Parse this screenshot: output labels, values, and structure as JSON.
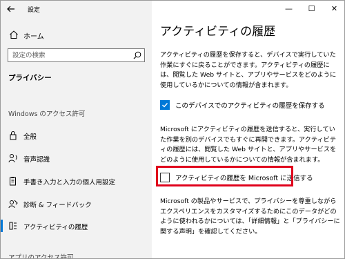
{
  "window": {
    "title": "設定",
    "controls": {
      "minimize": "—",
      "maximize": "☐",
      "close": "✕"
    }
  },
  "sidebar": {
    "home_label": "ホーム",
    "search_placeholder": "設定の検索",
    "privacy_heading": "プライバシー",
    "windows_permissions_heading": "Windows のアクセス許可",
    "items": [
      {
        "label": "全般",
        "icon": "lock-icon"
      },
      {
        "label": "音声認識",
        "icon": "microphone-person-icon"
      },
      {
        "label": "手書き入力と入力の個人用設定",
        "icon": "clipboard-pen-icon"
      },
      {
        "label": "診断 & フィードバック",
        "icon": "feedback-person-icon"
      },
      {
        "label": "アクティビティの履歴",
        "icon": "activity-history-icon",
        "active": true
      }
    ],
    "app_permissions_heading": "アプリのアクセス許可"
  },
  "main": {
    "title": "アクティビティの履歴",
    "para1": "アクティビティの履歴を保存すると、デバイスで実行していた作業にすぐに戻ることができます。アクティビティの履歴には、閲覧した Web サイトと、アプリやサービスをどのように使用しているかについての情報が含まれます。",
    "checkbox1": {
      "label": "このデバイスでのアクティビティの履歴を保存する",
      "checked": true
    },
    "para2": "Microsoft にアクティビティの履歴を送信すると、実行していた作業を別のデバイスでもすぐに再開できます。アクティビティの履歴には、閲覧した Web サイトと、アプリやサービスをどのように使用しているかについての情報が含まれます。",
    "checkbox2": {
      "label": "アクティビティの履歴を Microsoft に送信する",
      "checked": false
    },
    "para3": "Microsoft の製品やサービスで、プライバシーを尊重しながらエクスペリエンスをカスタマイズするためにこのデータがどのように使われるかについては、「詳細情報」と「プライバシーに関する声明」を確認してください。"
  },
  "colors": {
    "accent": "#0078d7",
    "sidebar_bg": "#f2f2f2",
    "highlight": "#e0001b"
  }
}
